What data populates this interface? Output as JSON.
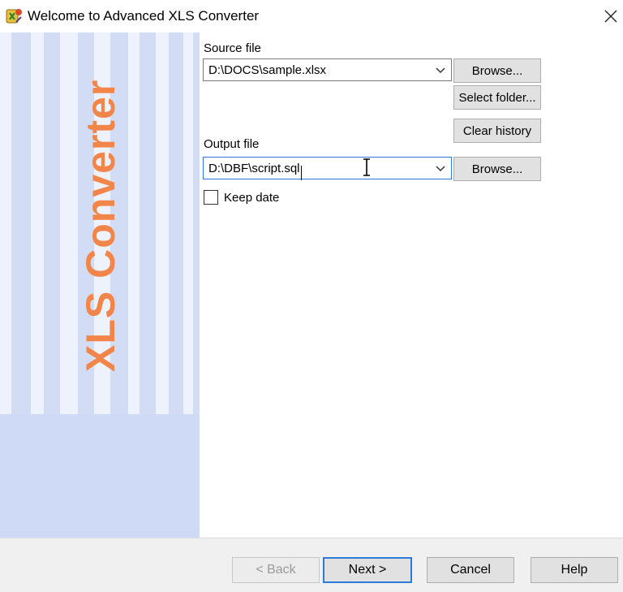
{
  "window": {
    "title": "Welcome to Advanced XLS Converter",
    "app_icon": "app-logo-icon",
    "close_icon": "close-icon"
  },
  "banner": {
    "text": "XLS Converter",
    "text_color": "#f2864a",
    "background_color": "#d2dcf5"
  },
  "source": {
    "label": "Source file",
    "value": "D:\\DOCS\\sample.xlsx",
    "browse_label": "Browse...",
    "select_folder_label": "Select folder...",
    "clear_history_label": "Clear history"
  },
  "output": {
    "label": "Output file",
    "value": "D:\\DBF\\script.sql",
    "browse_label": "Browse..."
  },
  "options": {
    "keep_date_label": "Keep date",
    "keep_date_checked": false
  },
  "footer": {
    "back_label": "< Back",
    "next_label": "Next >",
    "cancel_label": "Cancel",
    "help_label": "Help"
  },
  "colors": {
    "focus_border": "#2d7ad8",
    "button_face": "#e1e1e1"
  }
}
